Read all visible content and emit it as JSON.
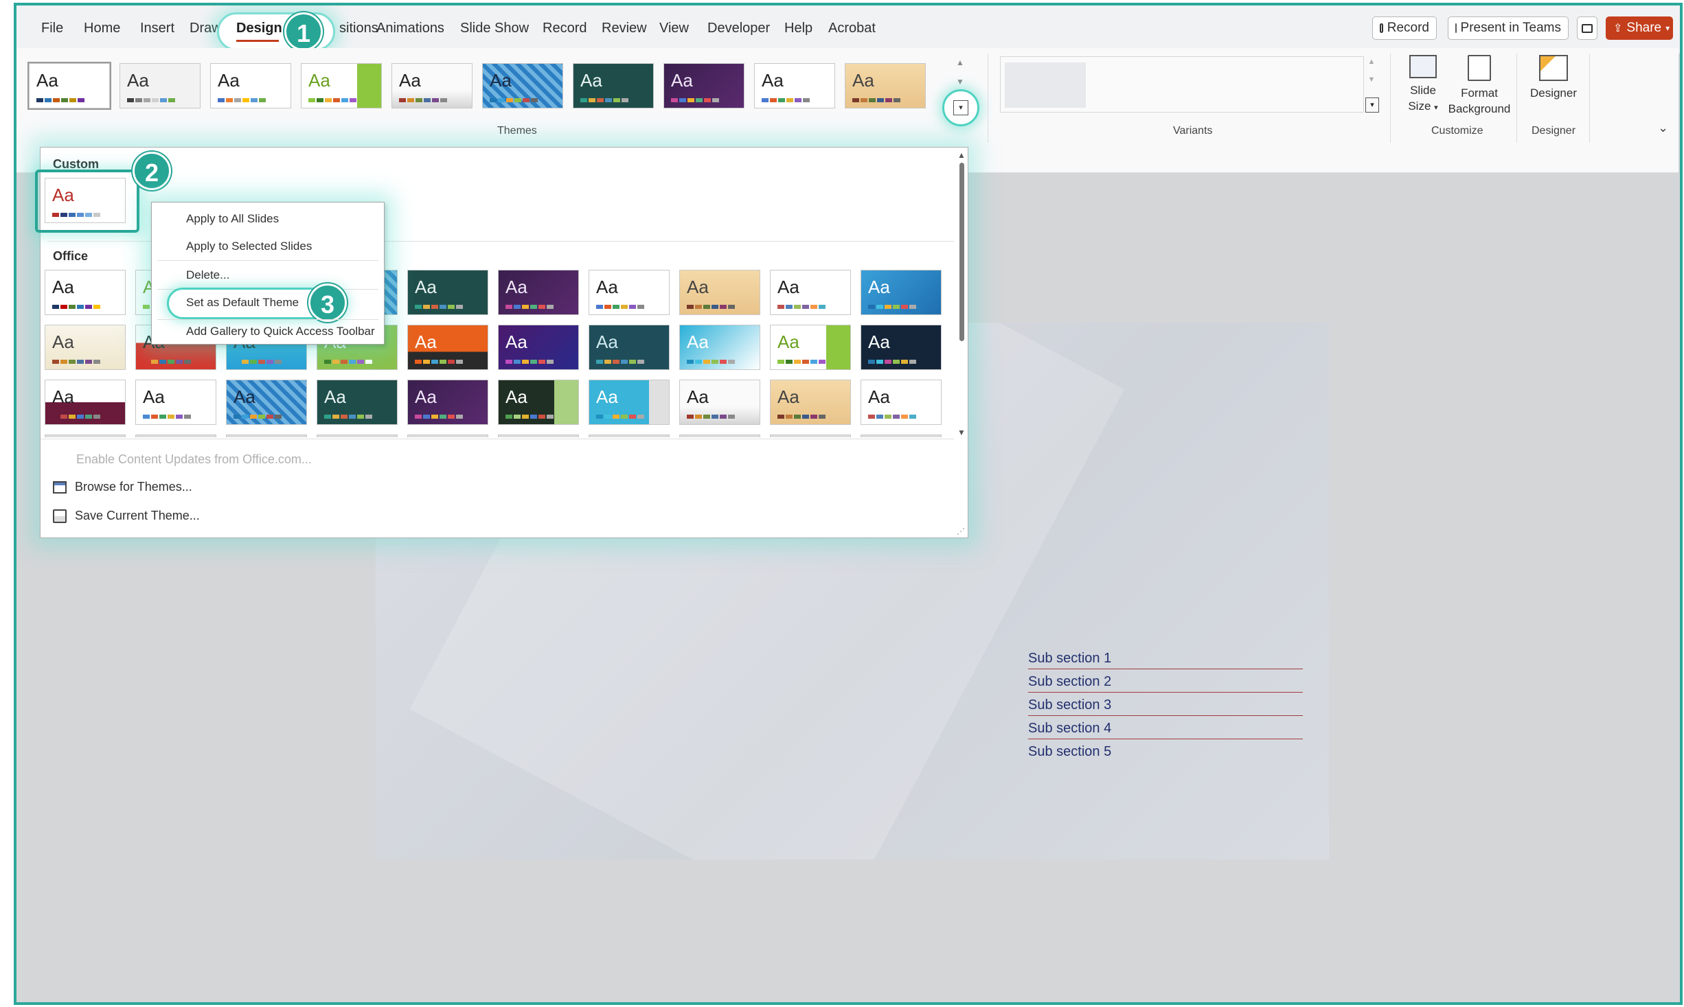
{
  "menubar": {
    "tabs": [
      "File",
      "Home",
      "Insert",
      "Draw",
      "Design",
      "Transitions",
      "Animations",
      "Slide Show",
      "Record",
      "Review",
      "View",
      "Developer",
      "Help",
      "Acrobat"
    ],
    "tab_file": "File",
    "tab_home": "Home",
    "tab_insert": "Insert",
    "tab_draw": "Draw",
    "tab_design": "Design",
    "tab_transitions": "sitions",
    "tab_animations": "Animations",
    "tab_slideshow": "Slide Show",
    "tab_record": "Record",
    "tab_review": "Review",
    "tab_view": "View",
    "tab_developer": "Developer",
    "tab_help": "Help",
    "tab_acrobat": "Acrobat",
    "record_btn": "Record",
    "present_btn": "Present in Teams",
    "share_btn": "Share"
  },
  "badges": {
    "one": "1",
    "two": "2",
    "three": "3"
  },
  "ribbon": {
    "themes_label": "Themes",
    "variants_label": "Variants",
    "customize_label": "Customize",
    "designer_label": "Designer",
    "slide_size_line1": "Slide",
    "slide_size_line2": "Size",
    "format_bg_line1": "Format",
    "format_bg_line2": "Background",
    "designer_btn": "Designer",
    "aa": "Aa"
  },
  "gallery": {
    "custom_heading": "Custom",
    "office_heading": "Office",
    "aa": "Aa",
    "footer": {
      "enable_updates": "Enable Content Updates from Office.com...",
      "browse": "Browse for Themes...",
      "save": "Save Current Theme..."
    }
  },
  "context_menu": {
    "apply_all": "Apply to All Slides",
    "apply_selected": "Apply to Selected Slides",
    "delete": "Delete...",
    "set_default": "Set as Default Theme",
    "add_gallery": "Add Gallery to Quick Access Toolbar"
  },
  "slide": {
    "subsections": [
      "Sub section 1",
      "Sub section 2",
      "Sub section 3",
      "Sub section 4",
      "Sub section 5"
    ]
  },
  "colors": {
    "accent_teal": "#27a595",
    "share_red": "#c43e1c"
  }
}
